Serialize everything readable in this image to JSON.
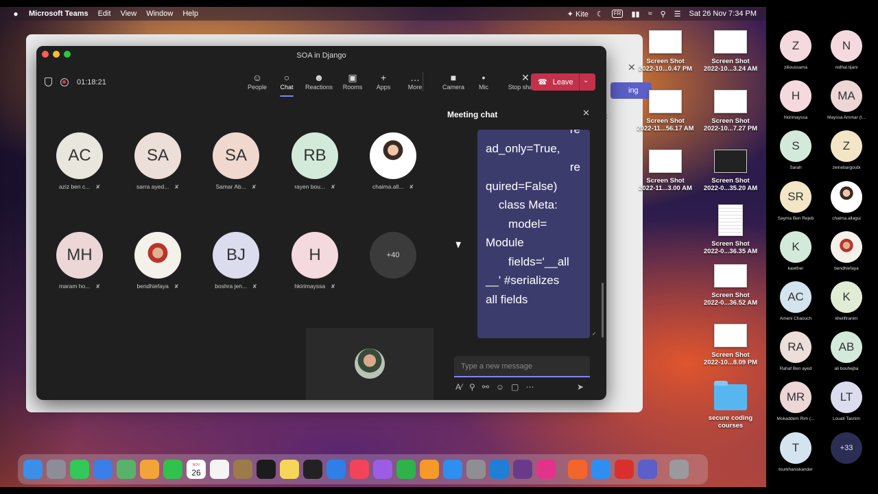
{
  "menubar": {
    "apple_icon": "apple-icon",
    "app_name": "Microsoft Teams",
    "items": [
      "Edit",
      "View",
      "Window",
      "Help"
    ],
    "kite": "Kite",
    "input_lang": "FR",
    "datetime": "Sat 26 Nov  7:34 PM"
  },
  "background_window": {
    "button_label": "ing",
    "side_text": "k"
  },
  "meeting": {
    "window_title": "SOA in Django",
    "timer": "01:18:21",
    "toolbar": [
      {
        "id": "people",
        "label": "People",
        "icon": "people-icon"
      },
      {
        "id": "chat",
        "label": "Chat",
        "icon": "chat-icon",
        "active": true
      },
      {
        "id": "reactions",
        "label": "Reactions",
        "icon": "reactions-icon"
      },
      {
        "id": "rooms",
        "label": "Rooms",
        "icon": "rooms-icon"
      },
      {
        "id": "apps",
        "label": "Apps",
        "icon": "plus-icon"
      },
      {
        "id": "more",
        "label": "More",
        "icon": "more-icon"
      },
      {
        "id": "camera",
        "label": "Camera",
        "icon": "camera-off-icon"
      },
      {
        "id": "mic",
        "label": "Mic",
        "icon": "mic-icon"
      },
      {
        "id": "share",
        "label": "Stop sharing",
        "icon": "stop-share-icon"
      }
    ],
    "leave_label": "Leave",
    "participants": [
      {
        "initials": "AC",
        "name": "aziz ben c...",
        "color": "#e9e6dd"
      },
      {
        "initials": "SA",
        "name": "sarra ayed...",
        "color": "#ecded8"
      },
      {
        "initials": "SA",
        "name": "Samar Ab...",
        "color": "#f0d8cf"
      },
      {
        "initials": "RB",
        "name": "rayen bou...",
        "color": "#d3eadb"
      },
      {
        "initials": "",
        "name": "chaima.all...",
        "photo": "photo-a"
      },
      {
        "initials": "MH",
        "name": "maram ho...",
        "color": "#ecd6d6"
      },
      {
        "initials": "",
        "name": "bendhiefaya",
        "photo": "photo-b"
      },
      {
        "initials": "BJ",
        "name": "boshra jen...",
        "color": "#dcdcef"
      },
      {
        "initials": "H",
        "name": "hkirimayssa",
        "color": "#f4d9de"
      }
    ],
    "overflow_count": "+40",
    "chat": {
      "title": "Meeting chat",
      "message_lines": [
        {
          "t": "re",
          "align": "right"
        },
        {
          "t": "ad_only=True,",
          "align": "left"
        },
        {
          "t": "re",
          "align": "right"
        },
        {
          "t": "quired=False)",
          "align": "left"
        },
        {
          "t": "    class Meta:",
          "align": "left"
        },
        {
          "t": "       model=",
          "align": "left"
        },
        {
          "t": "Module",
          "align": "left"
        },
        {
          "t": "       fields='__all",
          "align": "left"
        },
        {
          "t": "__' #serializes",
          "align": "left"
        },
        {
          "t": "all fields",
          "align": "left"
        }
      ],
      "input_placeholder": "Type a new message"
    }
  },
  "desktop_files": [
    {
      "l1": "Screen Shot",
      "l2": "2022-10...0.47 PM",
      "kind": "light"
    },
    {
      "l1": "Screen Shot",
      "l2": "2022-10...3.24 AM",
      "kind": "light"
    },
    {
      "l1": "Screen Shot",
      "l2": "2022-11...56.17 AM",
      "kind": "light"
    },
    {
      "l1": "Screen Shot",
      "l2": "2022-10...7.27 PM",
      "kind": "light"
    },
    {
      "l1": "Screen Shot",
      "l2": "2022-11...3.00 AM",
      "kind": "light"
    },
    {
      "l1": "Screen Shot",
      "l2": "2022-0...35.20 AM",
      "kind": "dark"
    },
    {
      "l1": "Screen Shot",
      "l2": "2022-0...36.35 AM",
      "kind": "doc"
    },
    {
      "l1": "Screen Shot",
      "l2": "2022-0...36.52 AM",
      "kind": "light"
    },
    {
      "l1": "Screen Shot",
      "l2": "2022-10...8.09 PM",
      "kind": "light"
    },
    {
      "l1": "secure coding",
      "l2": "courses",
      "kind": "folder"
    }
  ],
  "dock_calendar": {
    "month": "NOV",
    "day": "26"
  },
  "dock_apps": [
    {
      "name": "finder",
      "color": "#3b8fe8"
    },
    {
      "name": "launchpad",
      "color": "#8d8d99"
    },
    {
      "name": "messages",
      "color": "#34c759"
    },
    {
      "name": "mail",
      "color": "#3a7ee8"
    },
    {
      "name": "maps",
      "color": "#58b26a"
    },
    {
      "name": "photos",
      "color": "#f2a33a"
    },
    {
      "name": "facetime",
      "color": "#30c24a"
    },
    {
      "name": "calendar",
      "color": "#ffffff"
    },
    {
      "name": "reminders",
      "color": "#f4f4f4"
    },
    {
      "name": "notes-brown",
      "color": "#9c7a4a"
    },
    {
      "name": "appletv",
      "color": "#1c1c1e"
    },
    {
      "name": "notes",
      "color": "#f7d55a"
    },
    {
      "name": "terminal",
      "color": "#222222"
    },
    {
      "name": "keynote",
      "color": "#2f7fe8"
    },
    {
      "name": "music",
      "color": "#f1445a"
    },
    {
      "name": "podcasts",
      "color": "#9b5de5"
    },
    {
      "name": "numbers",
      "color": "#2fb24a"
    },
    {
      "name": "pages",
      "color": "#f39a2a"
    },
    {
      "name": "appstore",
      "color": "#2e8ff0"
    },
    {
      "name": "settings",
      "color": "#8e8e93"
    },
    {
      "name": "vscode",
      "color": "#1f7fd6"
    },
    {
      "name": "texshop",
      "color": "#6a3a8a"
    },
    {
      "name": "intellij",
      "color": "#e2338a"
    },
    {
      "name": "pen-app",
      "color": "#f2662b"
    },
    {
      "name": "safari",
      "color": "#2e8ff0"
    },
    {
      "name": "acrobat",
      "color": "#d9302d"
    },
    {
      "name": "teams",
      "color": "#5b5fc7"
    },
    {
      "name": "trash",
      "color": "#9a9a9e"
    }
  ],
  "right_panel": [
    {
      "initials": "Z",
      "name": "zilioussama",
      "color": "#f4d9de"
    },
    {
      "initials": "N",
      "name": "nidhal.tijani",
      "color": "#f4d9de"
    },
    {
      "initials": "H",
      "name": "hkirimayssa",
      "color": "#f4d9de"
    },
    {
      "initials": "MA",
      "name": "Mayssa Ammar (I...",
      "color": "#ecd6d6"
    },
    {
      "initials": "S",
      "name": "Sarah",
      "color": "#d3eadb"
    },
    {
      "initials": "Z",
      "name": "zeinebargoubi",
      "color": "#f3e6c6"
    },
    {
      "initials": "SR",
      "name": "Sayma Ben Rejeb",
      "color": "#f3e6c6"
    },
    {
      "initials": "",
      "name": "chaima.allagui",
      "photo": "photo-a"
    },
    {
      "initials": "K",
      "name": "kawther",
      "color": "#d3eadb"
    },
    {
      "initials": "",
      "name": "bendhiefaya",
      "photo": "photo-b"
    },
    {
      "initials": "AC",
      "name": "Ameni Chaouch",
      "color": "#d3e4ef"
    },
    {
      "initials": "K",
      "name": "khelifiranim",
      "color": "#e0ecd3"
    },
    {
      "initials": "RA",
      "name": "Rahaf Ben ayed",
      "color": "#ecded8"
    },
    {
      "initials": "AB",
      "name": "ali bouhejba",
      "color": "#d3eadb"
    },
    {
      "initials": "MR",
      "name": "Mokaddem Rim (...",
      "color": "#ecd6d6"
    },
    {
      "initials": "LT",
      "name": "Louati Tasnim",
      "color": "#dcdcef"
    },
    {
      "initials": "T",
      "name": "tourkhaniskander",
      "color": "#d3e4ef"
    },
    {
      "initials": "+33",
      "name": "",
      "more": true
    }
  ]
}
